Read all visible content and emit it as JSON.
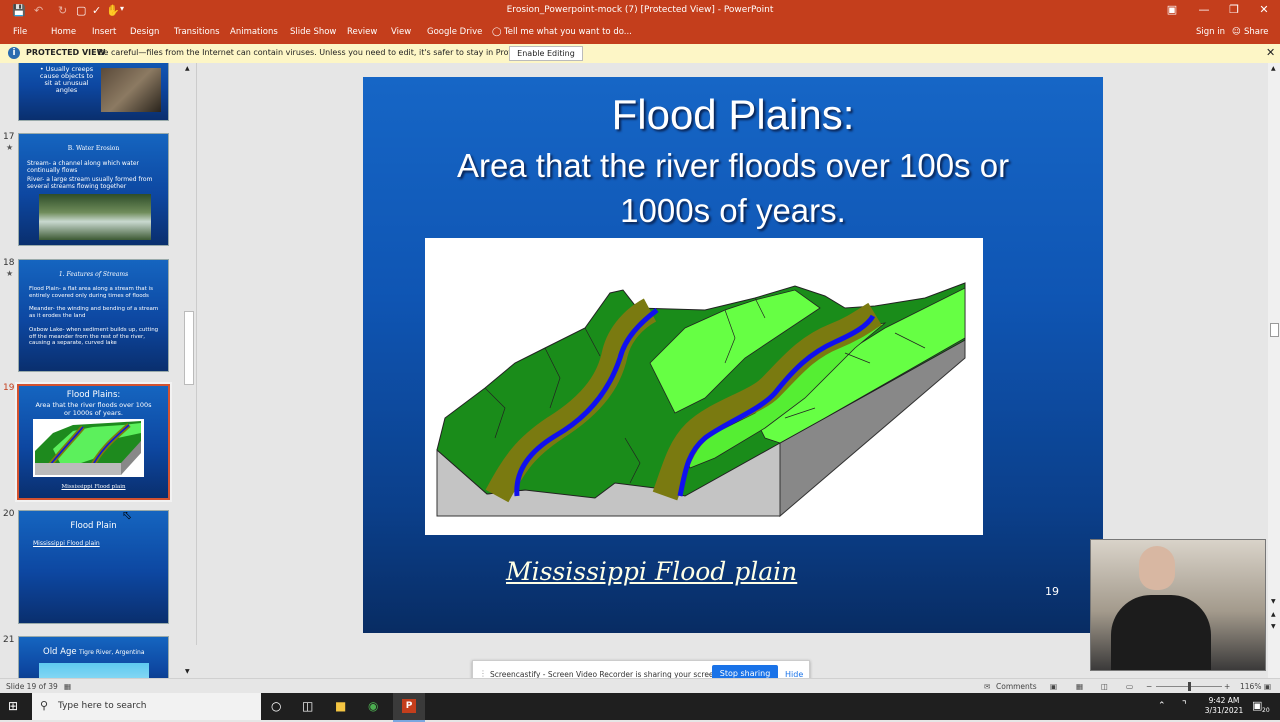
{
  "window": {
    "title": "Erosion_Powerpoint-mock (7) [Protected View] - PowerPoint",
    "sign_in": "Sign in",
    "share": "Share"
  },
  "ribbon": {
    "tabs": [
      "File",
      "Home",
      "Insert",
      "Design",
      "Transitions",
      "Animations",
      "Slide Show",
      "Review",
      "View",
      "Google Drive"
    ],
    "tell_me": "Tell me what you want to do..."
  },
  "protected_bar": {
    "label": "PROTECTED VIEW",
    "message": "Be careful—files from the Internet can contain viruses. Unless you need to edit, it's safer to stay in Protected View.",
    "button": "Enable Editing"
  },
  "thumbnails": [
    {
      "number": "",
      "text": "• Usually creeps cause objects to sit at unusual angles"
    },
    {
      "number": "17",
      "title": "B. Water Erosion",
      "bullets": [
        "Stream- a channel along which water continually flows",
        "River- a large stream usually formed from several streams flowing together"
      ]
    },
    {
      "number": "18",
      "title": "1. Features of Streams",
      "bullets": [
        "Flood Plain- a flat area along a stream that is entirely covered only during times of floods",
        "Meander- the winding and bending of a stream as it erodes the land",
        "Oxbow Lake- when sediment builds up, cutting off the meander from the rest of the river, causing a separate, curved lake"
      ]
    },
    {
      "number": "19",
      "title": "Flood Plains:",
      "subtitle": "Area that the river floods over 100s or 1000s of years.",
      "caption": "Mississippi Flood plain"
    },
    {
      "number": "20",
      "title": "Flood Plain",
      "bullets": [
        "Mississippi Flood plain"
      ]
    },
    {
      "number": "21",
      "title": "Old Age",
      "subtitle": "Tigre River, Argentina"
    }
  ],
  "slide": {
    "title": "Flood Plains:",
    "subtitle": "Area that the river floods over 100s or 1000s of years.",
    "link": "Mississippi Flood plain",
    "page_number": "19"
  },
  "sharing_bar": {
    "message": "Screencastify - Screen Video Recorder is sharing your screen.",
    "stop": "Stop sharing",
    "hide": "Hide"
  },
  "status": {
    "slide_info": "Slide 19 of 39",
    "comments": "Comments",
    "zoom": "116%"
  },
  "taskbar": {
    "search_placeholder": "Type here to search",
    "time": "9:42 AM",
    "date": "3/31/2021",
    "notifications": "20"
  },
  "colors": {
    "accent": "#c43e1c",
    "slide_blue": "#1565c0",
    "protected_bg": "#fdf6c6",
    "share_button": "#1a73e8"
  }
}
